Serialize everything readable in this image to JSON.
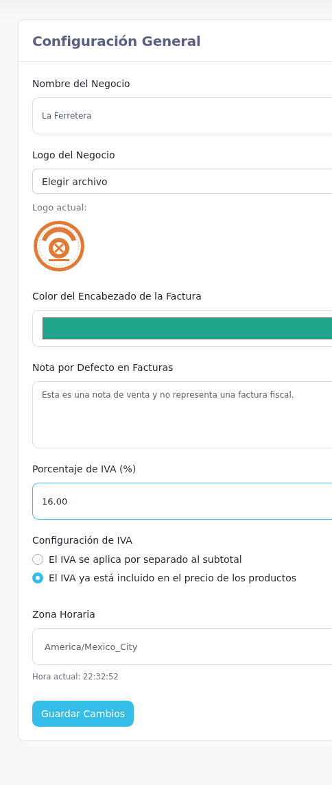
{
  "card": {
    "title": "Configuración General"
  },
  "fields": [
    {
      "kind": "text",
      "label": "Nombre del Negocio",
      "value": "La Ferretera",
      "focused": false
    },
    {
      "kind": "file",
      "label": "Logo del Negocio",
      "value": "Elegir archivo",
      "current_label": "Logo actual:"
    },
    {
      "kind": "color",
      "label": "Color del Encabezado de la Factura",
      "color": "#20a58c"
    },
    {
      "kind": "textarea",
      "label": "Nota por Defecto en Facturas",
      "value": "Esta es una nota de venta y no representa una factura fiscal."
    },
    {
      "kind": "text",
      "label": "Porcentaje de IVA (%)",
      "value": "16.00",
      "focused": true
    },
    {
      "kind": "radio",
      "label": "Configuración de IVA",
      "options": [
        {
          "label": "El IVA se aplica por separado al subtotal",
          "selected": false
        },
        {
          "label": "El IVA ya está incluido en el precio de los productos",
          "selected": true
        }
      ]
    },
    {
      "kind": "select",
      "label": "Zona Horaria",
      "value": "America/Mexico_City",
      "hint": "Hora actual: 22:32:52"
    }
  ],
  "save_button": "Guardar Cambios"
}
